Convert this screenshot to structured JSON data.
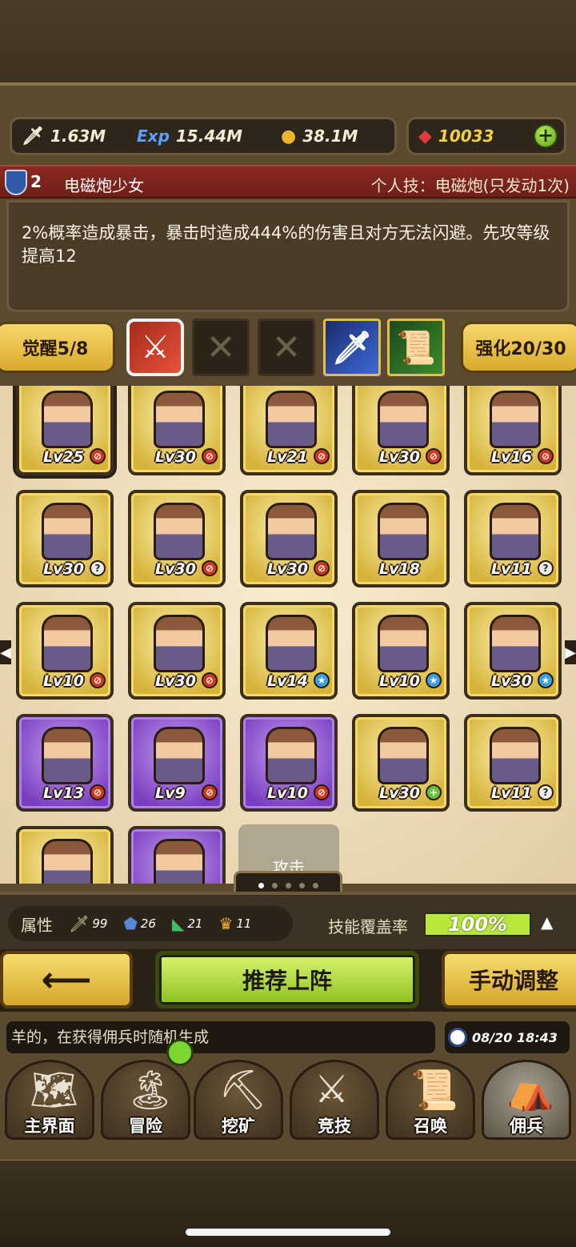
{
  "resources": {
    "attack": {
      "icon": "sword-icon",
      "value": "1.63M"
    },
    "exp": {
      "icon": "exp-icon",
      "label": "Exp",
      "value": "15.44M"
    },
    "coin": {
      "icon": "coin-icon",
      "value": "38.1M"
    },
    "gem": {
      "icon": "gem-icon",
      "value": "10033"
    }
  },
  "hero": {
    "rank": "2",
    "name": "电磁炮少女",
    "personal_skill": "个人技：电磁炮(只发动1次)",
    "description": "2%概率造成暴击，暴击时造成444%的伤害且对方无法闪避。先攻等级提高12"
  },
  "skill_row": {
    "awaken": "觉醒5/8",
    "enhance": "强化20/30",
    "slots": [
      {
        "icon": "sword-slash-skill-icon",
        "state": "selected"
      },
      {
        "icon": "empty-slot-x-icon",
        "state": "empty",
        "glyph": "✕"
      },
      {
        "icon": "empty-slot-x-icon",
        "state": "empty",
        "glyph": "✕"
      },
      {
        "icon": "blue-sword-skill-icon",
        "state": "equipped"
      },
      {
        "icon": "scroll-skill-icon",
        "state": "equipped"
      }
    ]
  },
  "heroes": [
    {
      "lv": "Lv25",
      "badge": "fire",
      "frame": "gold",
      "selected": true
    },
    {
      "lv": "Lv30",
      "badge": "fire",
      "frame": "gold"
    },
    {
      "lv": "Lv21",
      "badge": "fire",
      "frame": "gold"
    },
    {
      "lv": "Lv30",
      "badge": "fire",
      "frame": "gold"
    },
    {
      "lv": "Lv16",
      "badge": "fire",
      "frame": "gold"
    },
    {
      "lv": "Lv30",
      "badge": "question",
      "frame": "gold"
    },
    {
      "lv": "Lv30",
      "badge": "fire",
      "frame": "gold"
    },
    {
      "lv": "Lv30",
      "badge": "fire",
      "frame": "gold"
    },
    {
      "lv": "Lv18",
      "badge": "",
      "frame": "gold"
    },
    {
      "lv": "Lv11",
      "badge": "question",
      "frame": "gold"
    },
    {
      "lv": "Lv10",
      "badge": "fire",
      "frame": "gold"
    },
    {
      "lv": "Lv30",
      "badge": "fire",
      "frame": "gold"
    },
    {
      "lv": "Lv14",
      "badge": "star",
      "frame": "gold"
    },
    {
      "lv": "Lv10",
      "badge": "star",
      "frame": "gold"
    },
    {
      "lv": "Lv30",
      "badge": "star",
      "frame": "gold"
    },
    {
      "lv": "Lv13",
      "badge": "fire",
      "frame": "purple"
    },
    {
      "lv": "Lv9",
      "badge": "fire",
      "frame": "purple"
    },
    {
      "lv": "Lv10",
      "badge": "fire",
      "frame": "purple"
    },
    {
      "lv": "Lv30",
      "badge": "plus",
      "frame": "gold"
    },
    {
      "lv": "Lv11",
      "badge": "question",
      "frame": "gold"
    },
    {
      "lv": "",
      "badge": "",
      "frame": "gold"
    },
    {
      "lv": "",
      "badge": "",
      "frame": "purple"
    }
  ],
  "attack_tab": "攻击",
  "pager": {
    "pages": 5,
    "current": 1
  },
  "stats": {
    "label": "属性",
    "items": [
      {
        "icon": "sword-stat-icon",
        "value": "99"
      },
      {
        "icon": "shield-stat-icon",
        "value": "26"
      },
      {
        "icon": "boot-stat-icon",
        "value": "21"
      },
      {
        "icon": "crown-stat-icon",
        "value": "11"
      }
    ],
    "coverage_label": "技能覆盖率",
    "coverage_value": "100%",
    "coverage_fraction": 1.0
  },
  "actions": {
    "recommend": "推荐上阵",
    "manual": "手动调整"
  },
  "ticker": "羊的，在获得佣兵时随机生成",
  "clock": "08/20 18:43",
  "nav": [
    {
      "label": "主界面",
      "icon": "map-scroll-icon"
    },
    {
      "label": "冒险",
      "icon": "island-icon"
    },
    {
      "label": "挖矿",
      "icon": "pickaxe-icon"
    },
    {
      "label": "竞技",
      "icon": "crossed-swords-icon"
    },
    {
      "label": "召唤",
      "icon": "summon-scroll-icon"
    },
    {
      "label": "佣兵",
      "icon": "tent-icon"
    }
  ]
}
